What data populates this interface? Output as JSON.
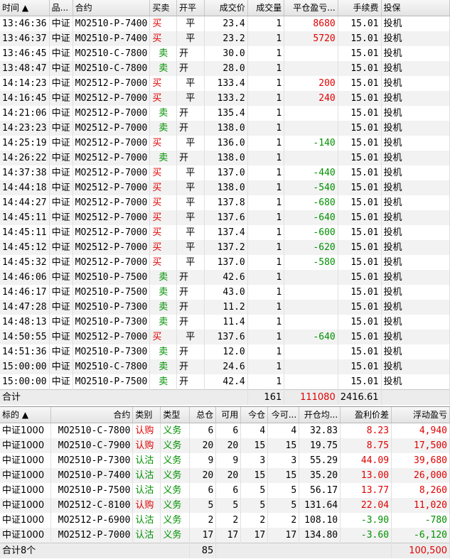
{
  "trades": {
    "columns": [
      "时间 ▲",
      "品...",
      "合约",
      "买卖",
      "开平",
      "成交价",
      "成交量",
      "平仓盈亏...",
      "手续费",
      "投保"
    ],
    "rows": [
      {
        "time": "13:46:36",
        "product": "中证",
        "contract": "MO2510-P-7400",
        "side": "买",
        "openclose": "平",
        "price": "23.4",
        "qty": "1",
        "pnl": "8680",
        "fee": "15.01",
        "hedge": "投机"
      },
      {
        "time": "13:46:37",
        "product": "中证",
        "contract": "MO2510-P-7400",
        "side": "买",
        "openclose": "平",
        "price": "23.2",
        "qty": "1",
        "pnl": "5720",
        "fee": "15.01",
        "hedge": "投机"
      },
      {
        "time": "13:46:45",
        "product": "中证",
        "contract": "MO2510-C-7800",
        "side": "卖",
        "openclose": "开",
        "price": "30.0",
        "qty": "1",
        "pnl": "",
        "fee": "15.01",
        "hedge": "投机"
      },
      {
        "time": "13:48:47",
        "product": "中证",
        "contract": "MO2510-C-7800",
        "side": "卖",
        "openclose": "开",
        "price": "28.0",
        "qty": "1",
        "pnl": "",
        "fee": "15.01",
        "hedge": "投机"
      },
      {
        "time": "14:14:23",
        "product": "中证",
        "contract": "MO2512-P-7000",
        "side": "买",
        "openclose": "平",
        "price": "133.4",
        "qty": "1",
        "pnl": "200",
        "fee": "15.01",
        "hedge": "投机"
      },
      {
        "time": "14:16:45",
        "product": "中证",
        "contract": "MO2512-P-7000",
        "side": "买",
        "openclose": "平",
        "price": "133.2",
        "qty": "1",
        "pnl": "240",
        "fee": "15.01",
        "hedge": "投机"
      },
      {
        "time": "14:21:06",
        "product": "中证",
        "contract": "MO2512-P-7000",
        "side": "卖",
        "openclose": "开",
        "price": "135.4",
        "qty": "1",
        "pnl": "",
        "fee": "15.01",
        "hedge": "投机"
      },
      {
        "time": "14:23:23",
        "product": "中证",
        "contract": "MO2512-P-7000",
        "side": "卖",
        "openclose": "开",
        "price": "138.0",
        "qty": "1",
        "pnl": "",
        "fee": "15.01",
        "hedge": "投机"
      },
      {
        "time": "14:25:19",
        "product": "中证",
        "contract": "MO2512-P-7000",
        "side": "买",
        "openclose": "平",
        "price": "136.0",
        "qty": "1",
        "pnl": "-140",
        "fee": "15.01",
        "hedge": "投机"
      },
      {
        "time": "14:26:22",
        "product": "中证",
        "contract": "MO2512-P-7000",
        "side": "卖",
        "openclose": "开",
        "price": "138.0",
        "qty": "1",
        "pnl": "",
        "fee": "15.01",
        "hedge": "投机"
      },
      {
        "time": "14:37:38",
        "product": "中证",
        "contract": "MO2512-P-7000",
        "side": "买",
        "openclose": "平",
        "price": "137.0",
        "qty": "1",
        "pnl": "-440",
        "fee": "15.01",
        "hedge": "投机"
      },
      {
        "time": "14:44:18",
        "product": "中证",
        "contract": "MO2512-P-7000",
        "side": "买",
        "openclose": "平",
        "price": "138.0",
        "qty": "1",
        "pnl": "-540",
        "fee": "15.01",
        "hedge": "投机"
      },
      {
        "time": "14:44:27",
        "product": "中证",
        "contract": "MO2512-P-7000",
        "side": "买",
        "openclose": "平",
        "price": "137.8",
        "qty": "1",
        "pnl": "-680",
        "fee": "15.01",
        "hedge": "投机"
      },
      {
        "time": "14:45:11",
        "product": "中证",
        "contract": "MO2512-P-7000",
        "side": "买",
        "openclose": "平",
        "price": "137.6",
        "qty": "1",
        "pnl": "-640",
        "fee": "15.01",
        "hedge": "投机"
      },
      {
        "time": "14:45:11",
        "product": "中证",
        "contract": "MO2512-P-7000",
        "side": "买",
        "openclose": "平",
        "price": "137.4",
        "qty": "1",
        "pnl": "-600",
        "fee": "15.01",
        "hedge": "投机"
      },
      {
        "time": "14:45:12",
        "product": "中证",
        "contract": "MO2512-P-7000",
        "side": "买",
        "openclose": "平",
        "price": "137.2",
        "qty": "1",
        "pnl": "-620",
        "fee": "15.01",
        "hedge": "投机"
      },
      {
        "time": "14:45:32",
        "product": "中证",
        "contract": "MO2512-P-7000",
        "side": "买",
        "openclose": "平",
        "price": "137.0",
        "qty": "1",
        "pnl": "-580",
        "fee": "15.01",
        "hedge": "投机"
      },
      {
        "time": "14:46:06",
        "product": "中证",
        "contract": "MO2510-P-7500",
        "side": "卖",
        "openclose": "开",
        "price": "42.6",
        "qty": "1",
        "pnl": "",
        "fee": "15.01",
        "hedge": "投机"
      },
      {
        "time": "14:46:17",
        "product": "中证",
        "contract": "MO2510-P-7500",
        "side": "卖",
        "openclose": "开",
        "price": "43.0",
        "qty": "1",
        "pnl": "",
        "fee": "15.01",
        "hedge": "投机"
      },
      {
        "time": "14:47:28",
        "product": "中证",
        "contract": "MO2510-P-7300",
        "side": "卖",
        "openclose": "开",
        "price": "11.2",
        "qty": "1",
        "pnl": "",
        "fee": "15.01",
        "hedge": "投机"
      },
      {
        "time": "14:48:13",
        "product": "中证",
        "contract": "MO2510-P-7300",
        "side": "卖",
        "openclose": "开",
        "price": "11.4",
        "qty": "1",
        "pnl": "",
        "fee": "15.01",
        "hedge": "投机"
      },
      {
        "time": "14:50:55",
        "product": "中证",
        "contract": "MO2512-P-7000",
        "side": "买",
        "openclose": "平",
        "price": "137.6",
        "qty": "1",
        "pnl": "-640",
        "fee": "15.01",
        "hedge": "投机"
      },
      {
        "time": "14:51:36",
        "product": "中证",
        "contract": "MO2510-P-7300",
        "side": "卖",
        "openclose": "开",
        "price": "12.0",
        "qty": "1",
        "pnl": "",
        "fee": "15.01",
        "hedge": "投机"
      },
      {
        "time": "15:00:00",
        "product": "中证",
        "contract": "MO2510-C-7800",
        "side": "卖",
        "openclose": "开",
        "price": "24.6",
        "qty": "1",
        "pnl": "",
        "fee": "15.01",
        "hedge": "投机"
      },
      {
        "time": "15:00:00",
        "product": "中证",
        "contract": "MO2510-P-7500",
        "side": "卖",
        "openclose": "开",
        "price": "42.4",
        "qty": "1",
        "pnl": "",
        "fee": "15.01",
        "hedge": "投机"
      }
    ],
    "summary": {
      "label": "合计",
      "qty": "161",
      "pnl": "111080",
      "fee": "2416.61"
    }
  },
  "positions": {
    "columns": [
      "标的 ▲",
      "合约",
      "类别",
      "类型",
      "总仓",
      "可用",
      "今仓",
      "今可...",
      "开仓均...",
      "盈利价差",
      "浮动盈亏"
    ],
    "rows": [
      {
        "underlying": "中证1000",
        "contract": "MO2510-C-7800",
        "category": "认购",
        "type": "义务",
        "total": "6",
        "avail": "6",
        "today": "4",
        "today_avail": "4",
        "avg": "32.83",
        "spread": "8.23",
        "float": "4,940"
      },
      {
        "underlying": "中证1000",
        "contract": "MO2510-C-7900",
        "category": "认购",
        "type": "义务",
        "total": "20",
        "avail": "20",
        "today": "15",
        "today_avail": "15",
        "avg": "19.75",
        "spread": "8.75",
        "float": "17,500"
      },
      {
        "underlying": "中证1000",
        "contract": "MO2510-P-7300",
        "category": "认沽",
        "type": "义务",
        "total": "9",
        "avail": "9",
        "today": "3",
        "today_avail": "3",
        "avg": "55.29",
        "spread": "44.09",
        "float": "39,680"
      },
      {
        "underlying": "中证1000",
        "contract": "MO2510-P-7400",
        "category": "认沽",
        "type": "义务",
        "total": "20",
        "avail": "20",
        "today": "15",
        "today_avail": "15",
        "avg": "35.20",
        "spread": "13.00",
        "float": "26,000"
      },
      {
        "underlying": "中证1000",
        "contract": "MO2510-P-7500",
        "category": "认沽",
        "type": "义务",
        "total": "6",
        "avail": "6",
        "today": "5",
        "today_avail": "5",
        "avg": "56.17",
        "spread": "13.77",
        "float": "8,260"
      },
      {
        "underlying": "中证1000",
        "contract": "MO2512-C-8100",
        "category": "认购",
        "type": "义务",
        "total": "5",
        "avail": "5",
        "today": "5",
        "today_avail": "5",
        "avg": "131.64",
        "spread": "22.04",
        "float": "11,020"
      },
      {
        "underlying": "中证1000",
        "contract": "MO2512-P-6900",
        "category": "认沽",
        "type": "义务",
        "total": "2",
        "avail": "2",
        "today": "2",
        "today_avail": "2",
        "avg": "108.10",
        "spread": "-3.90",
        "float": "-780"
      },
      {
        "underlying": "中证1000",
        "contract": "MO2512-P-7000",
        "category": "认沽",
        "type": "义务",
        "total": "17",
        "avail": "17",
        "today": "17",
        "today_avail": "17",
        "avg": "134.80",
        "spread": "-3.60",
        "float": "-6,120"
      }
    ],
    "summary": {
      "label": "合计8个",
      "total": "85",
      "float": "100,500"
    }
  },
  "colors": {
    "buy": "#e00000",
    "sell": "#009000",
    "profit": "#e00000",
    "loss": "#009000"
  }
}
